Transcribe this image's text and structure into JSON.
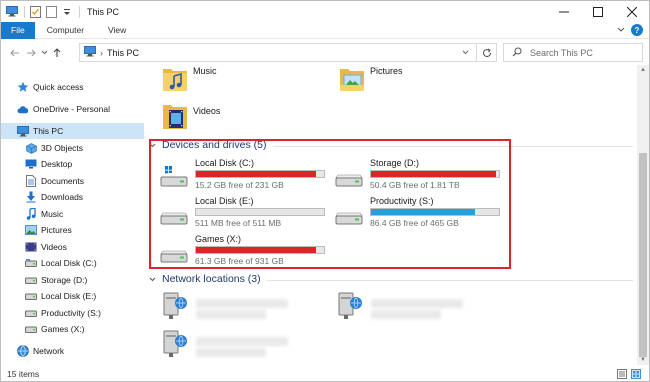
{
  "window": {
    "title": "This PC",
    "controls": [
      "minimize",
      "maximize",
      "close"
    ]
  },
  "ribbon": {
    "tabs": [
      "File",
      "Computer",
      "View"
    ]
  },
  "address": {
    "crumb": "This PC"
  },
  "search": {
    "placeholder": "Search This PC"
  },
  "sidebar": {
    "items": [
      {
        "label": "Quick access",
        "icon": "star-icon"
      },
      {
        "label": "OneDrive - Personal",
        "icon": "cloud-icon"
      },
      {
        "label": "This PC",
        "icon": "computer-icon",
        "selected": true
      },
      {
        "label": "3D Objects",
        "icon": "cube-icon"
      },
      {
        "label": "Desktop",
        "icon": "desktop-icon"
      },
      {
        "label": "Documents",
        "icon": "documents-icon"
      },
      {
        "label": "Downloads",
        "icon": "download-icon"
      },
      {
        "label": "Music",
        "icon": "music-icon"
      },
      {
        "label": "Pictures",
        "icon": "pictures-icon"
      },
      {
        "label": "Videos",
        "icon": "videos-icon"
      },
      {
        "label": "Local Disk (C:)",
        "icon": "drive-icon"
      },
      {
        "label": "Storage (D:)",
        "icon": "drive-icon"
      },
      {
        "label": "Local Disk (E:)",
        "icon": "drive-icon"
      },
      {
        "label": "Productivity (S:)",
        "icon": "drive-icon"
      },
      {
        "label": "Games (X:)",
        "icon": "drive-icon"
      },
      {
        "label": "Network",
        "icon": "network-icon"
      }
    ]
  },
  "folders": [
    {
      "label": "Music",
      "icon": "music-folder-icon"
    },
    {
      "label": "Pictures",
      "icon": "pictures-folder-icon"
    },
    {
      "label": "Videos",
      "icon": "videos-folder-icon"
    }
  ],
  "groups": {
    "devices": "Devices and drives (5)",
    "network": "Network locations (3)"
  },
  "drives": [
    {
      "name": "Local Disk (C:)",
      "info": "15.2 GB free of 231 GB",
      "used_fraction": 0.934,
      "bar_color": "#da2626",
      "icon": "windows-drive-icon"
    },
    {
      "name": "Storage (D:)",
      "info": "50.4 GB free of 1.81 TB",
      "used_fraction": 0.973,
      "bar_color": "#da2626",
      "icon": "hard-drive-icon"
    },
    {
      "name": "Local Disk (E:)",
      "info": "511 MB free of 511 MB",
      "used_fraction": 0.0,
      "bar_color": "#26a0da",
      "icon": "hard-drive-icon"
    },
    {
      "name": "Productivity (S:)",
      "info": "86.4 GB free of 465 GB",
      "used_fraction": 0.814,
      "bar_color": "#26a0da",
      "icon": "hard-drive-icon"
    },
    {
      "name": "Games (X:)",
      "info": "61.3 GB free of 931 GB",
      "used_fraction": 0.934,
      "bar_color": "#da2626",
      "icon": "hard-drive-icon"
    }
  ],
  "network_locations": [
    {
      "icon": "network-drive-icon"
    },
    {
      "icon": "network-drive-icon"
    },
    {
      "icon": "network-drive-icon"
    }
  ],
  "status": {
    "items": "15 items"
  },
  "colors": {
    "accent": "#1979ca",
    "highlight_box": "#d9252b",
    "selected_bg": "#cce4f7",
    "group_header": "#1e3a6e"
  }
}
